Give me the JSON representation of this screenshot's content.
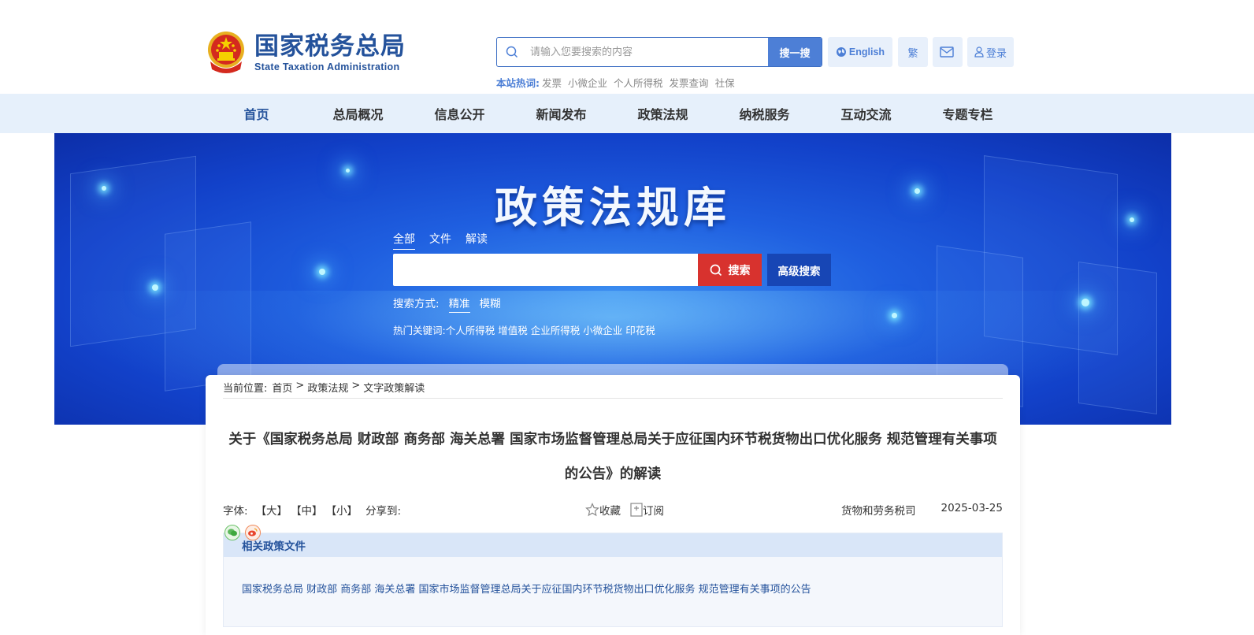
{
  "header": {
    "logo_cn": "国家税务总局",
    "logo_en": "State Taxation Administration",
    "search_placeholder": "请输入您要搜索的内容",
    "search_button": "搜一搜",
    "english_label": "English",
    "traditional_label": "繁",
    "login_label": "登录",
    "hotwords_label": "本站热词:",
    "hotwords": [
      "发票",
      "小微企业",
      "个人所得税",
      "发票查询",
      "社保"
    ]
  },
  "nav": {
    "items": [
      "首页",
      "总局概况",
      "信息公开",
      "新闻发布",
      "政策法规",
      "纳税服务",
      "互动交流",
      "专题专栏"
    ]
  },
  "banner": {
    "title": "政策法规库",
    "tabs": [
      "全部",
      "文件",
      "解读"
    ],
    "search_button": "搜索",
    "advanced_button": "高级搜索",
    "mode_label": "搜索方式:",
    "modes": [
      "精准",
      "模糊"
    ],
    "hot_label": "热门关键词:",
    "hot_keywords": [
      "个人所得税",
      "增值税",
      "企业所得税",
      "小微企业",
      "印花税"
    ]
  },
  "breadcrumb": {
    "label": "当前位置:",
    "items": [
      "首页",
      "政策法规",
      "文字政策解读"
    ],
    "sep": ">"
  },
  "article": {
    "title_line1": "关于《国家税务总局 财政部 商务部 海关总署 国家市场监督管理总局关于应征国内环节税货物出口优化服务 规范管理有关事项",
    "title_line2": "的公告》的解读",
    "font_label": "字体:",
    "font_sizes": [
      "【大】",
      "【中】",
      "【小】"
    ],
    "share_label": "分享到:",
    "favorite_label": "收藏",
    "subscribe_label": "订阅",
    "department": "货物和劳务税司",
    "date": "2025-03-25"
  },
  "related": {
    "heading": "相关政策文件",
    "link": "国家税务总局 财政部 商务部 海关总署 国家市场监督管理总局关于应征国内环节税货物出口优化服务 规范管理有关事项的公告"
  },
  "colors": {
    "brand_blue": "#24529b",
    "accent_blue": "#4d7fd6",
    "search_red": "#d8322e",
    "nav_bg": "#e6f0fb"
  }
}
